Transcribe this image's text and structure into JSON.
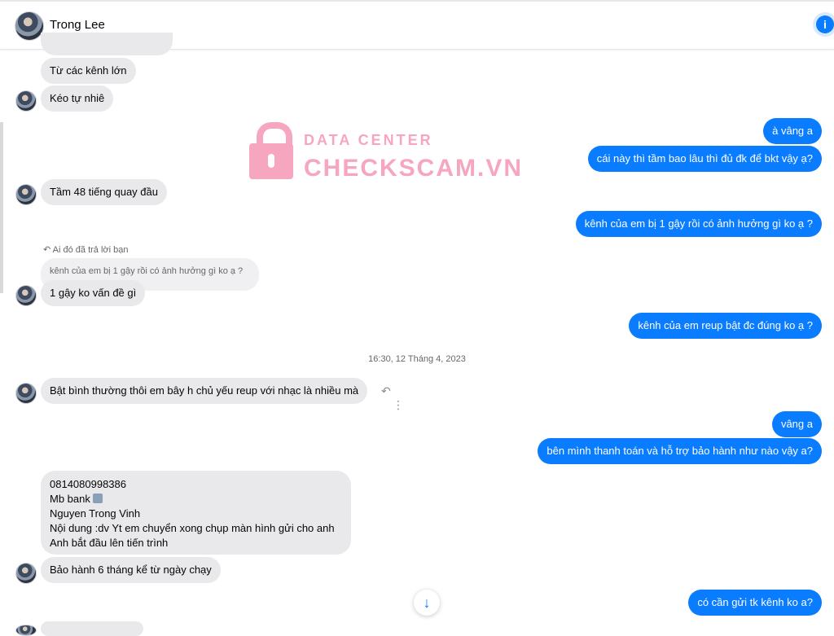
{
  "header": {
    "name": "Trong Lee",
    "info_icon": "info-icon"
  },
  "watermark": {
    "line1": "DATA CENTER",
    "line2": "CHECKSCAM.VN"
  },
  "messages": {
    "m1": "Từ các kênh lớn",
    "m2": "Kéo tự nhiê",
    "m3": "à vâng a",
    "m4": "cái này thì tầm bao lâu thì đủ đk để bkt vậy ạ?",
    "m5": "Tầm 48 tiếng quay đầu",
    "m6": "kênh của em bị 1 gậy rồi có ảnh hưởng gì ko ạ ?",
    "reply_note": "Ai đó đã trả lời bạn",
    "reply_quote": "kênh của em bị 1 gậy rồi có ảnh hưởng gì ko ạ ?",
    "m7": "1 gậy ko vấn đề gì",
    "m8": "kênh của em reup bật đc đúng ko ạ ?",
    "timestamp": "16:30, 12 Tháng 4, 2023",
    "m9": "Bật bình thường thôi em bây h chủ yếu reup với nhạc là nhiều mà",
    "m10": "vâng a",
    "m11": "bên mình thanh toán và hỗ trợ bảo hành như nào vậy a?",
    "m12_line1": "0814080998386",
    "m12_line2": "Mb bank",
    "m12_line3": "Nguyen Trong Vinh",
    "m12_line4": "Nội dung :dv Yt em chuyển xong chụp màn hình gửi cho anh",
    "m12_line5": "Anh bắt đầu lên tiến trình",
    "m13": "Bảo hành 6 tháng kể từ ngày chạy",
    "m14": "có cần gửi tk kênh ko a?"
  },
  "icons": {
    "reply": "reply-icon",
    "more": "more-vertical-icon",
    "scroll": "arrow-down-icon",
    "bank": "bank-icon"
  },
  "colors": {
    "accent": "#0a7cff",
    "bubble_gray": "#e9e9eb",
    "watermark": "#f7a6bf"
  }
}
